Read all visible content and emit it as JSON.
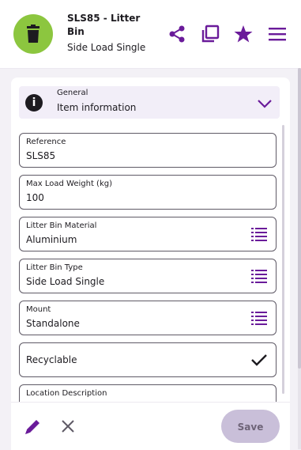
{
  "header": {
    "title": "SLS85 - Litter Bin",
    "subtitle": "Side Load Single",
    "accent": "#6a1b9a",
    "avatar_color": "#8cc63f",
    "icons": [
      "trash-icon",
      "share-icon",
      "copy-icon",
      "star-icon",
      "menu-icon"
    ]
  },
  "section": {
    "label": "General",
    "title": "Item information"
  },
  "fields": {
    "reference": {
      "label": "Reference",
      "value": "SLS85"
    },
    "max_load": {
      "label": "Max Load Weight (kg)",
      "value": "100"
    },
    "material": {
      "label": "Litter Bin Material",
      "value": "Aluminium"
    },
    "type": {
      "label": "Litter Bin Type",
      "value": "Side Load Single"
    },
    "mount": {
      "label": "Mount",
      "value": "Standalone"
    },
    "recyclable": {
      "value": "Recyclable",
      "checked": true
    },
    "location": {
      "label": "Location Description"
    }
  },
  "footer": {
    "save_label": "Save"
  }
}
